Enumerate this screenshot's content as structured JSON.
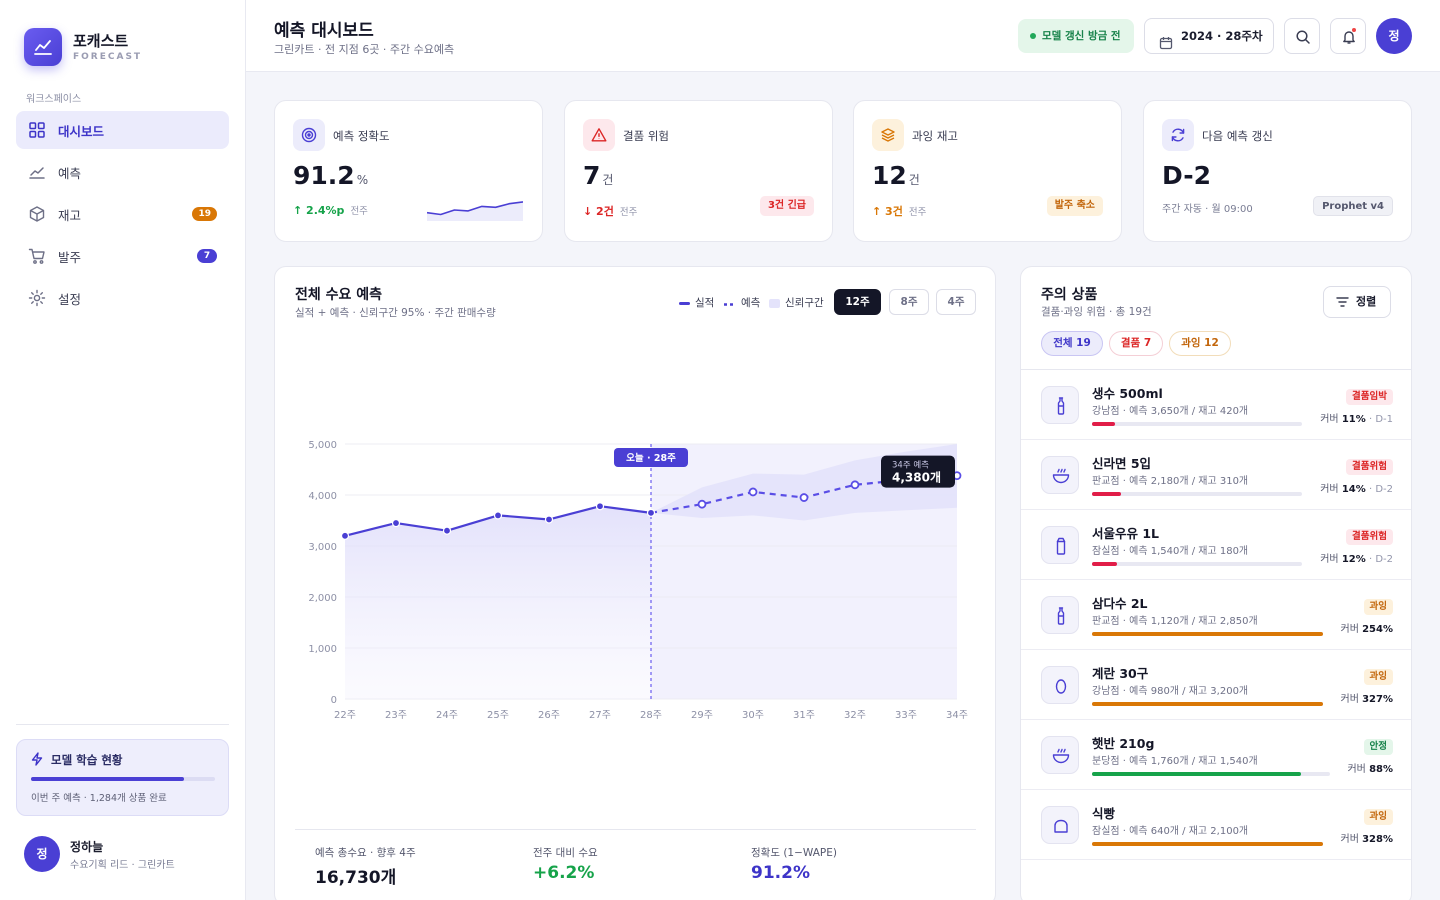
{
  "brand": {
    "name": "포캐스트",
    "sub": "FORECAST"
  },
  "sidebar": {
    "section_label": "워크스페이스",
    "items": [
      {
        "label": "대시보드",
        "icon": "grid-icon",
        "active": true
      },
      {
        "label": "예측",
        "icon": "trend-icon"
      },
      {
        "label": "재고",
        "icon": "box-icon",
        "badge": "19",
        "badge_color": "#d97706"
      },
      {
        "label": "발주",
        "icon": "cart-icon",
        "badge": "7",
        "badge_color": "#4a3fd4"
      },
      {
        "label": "설정",
        "icon": "gear-icon"
      }
    ],
    "training": {
      "title": "모델 학습 현황",
      "progress": 0.83,
      "text": "이번 주 예측 · 1,284개 상품 완료"
    },
    "user": {
      "initial": "정",
      "name": "정하늘",
      "role": "수요기획 리드 · 그린카트"
    }
  },
  "header": {
    "title": "예측 대시보드",
    "subtitle": "그린카트 · 전 지점 6곳 · 주간 수요예측",
    "status": "모델 갱신 방금 전",
    "date": "2024 · 28주차",
    "avatar": "정"
  },
  "kpis": [
    {
      "label": "예측 정확도",
      "value": "91.2",
      "unit": "%",
      "delta": "↑ 2.4%p",
      "delta_sub": "전주",
      "delta_color": "#16a34a",
      "icon": "target-icon",
      "icon_bg": "#ececfb",
      "icon_color": "#4a3fd4",
      "spark": [
        0.35,
        0.25,
        0.5,
        0.45,
        0.7,
        0.65,
        0.85,
        0.95
      ]
    },
    {
      "label": "결품 위험",
      "value": "7",
      "unit": "건",
      "delta": "↓ 2건",
      "delta_sub": "전주",
      "delta_color": "#dc2626",
      "tag": "3건 긴급",
      "tag_bg": "#fde8ec",
      "tag_color": "#dc2626",
      "icon": "warning-icon",
      "icon_bg": "#fde8ec",
      "icon_color": "#dc2626"
    },
    {
      "label": "과잉 재고",
      "value": "12",
      "unit": "건",
      "delta": "↑ 3건",
      "delta_sub": "전주",
      "delta_color": "#d97706",
      "tag": "발주 축소",
      "tag_bg": "#fdf1dc",
      "tag_color": "#c2650a",
      "icon": "layers-icon",
      "icon_bg": "#fdf1dc",
      "icon_color": "#d97706"
    },
    {
      "label": "다음 예측 갱신",
      "value": "D-2",
      "unit": "",
      "delta": "주간 자동 · 월 09:00",
      "delta_sub": "",
      "delta_color": "#7a7d94",
      "tag": "Prophet v4",
      "tag_bg": "#f0f1f6",
      "tag_color": "#55586e",
      "icon": "refresh-icon",
      "icon_bg": "#ececfb",
      "icon_color": "#4a3fd4"
    }
  ],
  "forecast": {
    "title": "전체 수요 예측",
    "subtitle": "실적 + 예측 · 신뢰구간 95% · 주간 판매수량",
    "legend": {
      "actual": "실적",
      "forecast": "예측",
      "ci": "신뢰구간"
    },
    "ranges": [
      "12주",
      "8주",
      "4주"
    ],
    "active_range": "12주",
    "today_label": "오늘 · 28주",
    "tooltip": {
      "title": "34주 예측",
      "value": "4,380개"
    },
    "summary": [
      {
        "label": "예측 총수요 · 향후 4주",
        "value": "16,730개",
        "color": "#141627"
      },
      {
        "label": "전주 대비 수요",
        "value": "+6.2%",
        "color": "#16a34a"
      },
      {
        "label": "정확도 (1−WAPE)",
        "value": "91.2%",
        "color": "#3d34c8"
      }
    ]
  },
  "chart_data": {
    "type": "line",
    "x": [
      "22주",
      "23주",
      "24주",
      "25주",
      "26주",
      "27주",
      "28주",
      "29주",
      "30주",
      "31주",
      "32주",
      "33주",
      "34주"
    ],
    "ylim": [
      0,
      5000
    ],
    "yticks": [
      0,
      1000,
      2000,
      3000,
      4000,
      5000
    ],
    "ytick_labels": [
      "0",
      "1,000",
      "2,000",
      "3,000",
      "4,000",
      "5,000"
    ],
    "grid": true,
    "legend_position": "top-right",
    "series": [
      {
        "name": "실적",
        "values": [
          3200,
          3450,
          3300,
          3600,
          3520,
          3780,
          3650,
          null,
          null,
          null,
          null,
          null,
          null
        ]
      },
      {
        "name": "예측",
        "values": [
          null,
          null,
          null,
          null,
          null,
          null,
          3650,
          3820,
          4060,
          3950,
          4200,
          4300,
          4380
        ]
      }
    ],
    "ci": {
      "lower": [
        null,
        null,
        null,
        null,
        null,
        null,
        3650,
        3550,
        3600,
        3500,
        3650,
        3700,
        3750
      ],
      "upper": [
        null,
        null,
        null,
        null,
        null,
        null,
        3650,
        4150,
        4420,
        4400,
        4680,
        4850,
        5000
      ]
    },
    "colors": {
      "actual": "#4a3fd4",
      "forecast": "#5a4ee6",
      "ci": "#e4e3fb"
    }
  },
  "items": {
    "title": "주의 상품",
    "subtitle": "결품·과잉 위험 · 총 19건",
    "sort_label": "정렬",
    "filters": [
      {
        "label": "전체 19",
        "bg": "#ececfb",
        "color": "#3d34c8",
        "border": "#c9c6f3"
      },
      {
        "label": "결품 7",
        "bg": "#fff",
        "color": "#dc2626",
        "border": "#f4cfd6"
      },
      {
        "label": "과잉 12",
        "bg": "#fff",
        "color": "#c2650a",
        "border": "#f2ddba"
      }
    ],
    "list": [
      {
        "name": "생수 500ml",
        "meta": "강남점 · 예측 3,650개 / 재고 420개",
        "tag": "결품임박",
        "tag_bg": "#fde8ec",
        "tag_color": "#dc2626",
        "cover_label": "커버",
        "cover_value": "11%",
        "dday": "D-1",
        "bar": 0.11,
        "bar_color": "#e11d48",
        "icon": "bottle-icon"
      },
      {
        "name": "신라면 5입",
        "meta": "판교점 · 예측 2,180개 / 재고 310개",
        "tag": "결품위험",
        "tag_bg": "#fde8ec",
        "tag_color": "#dc2626",
        "cover_label": "커버",
        "cover_value": "14%",
        "dday": "D-2",
        "bar": 0.14,
        "bar_color": "#e11d48",
        "icon": "bowl-icon"
      },
      {
        "name": "서울우유 1L",
        "meta": "잠실점 · 예측 1,540개 / 재고 180개",
        "tag": "결품위험",
        "tag_bg": "#fde8ec",
        "tag_color": "#dc2626",
        "cover_label": "커버",
        "cover_value": "12%",
        "dday": "D-2",
        "bar": 0.12,
        "bar_color": "#e11d48",
        "icon": "carton-icon"
      },
      {
        "name": "삼다수 2L",
        "meta": "판교점 · 예측 1,120개 / 재고 2,850개",
        "tag": "과잉",
        "tag_bg": "#fdf1dc",
        "tag_color": "#c2650a",
        "cover_label": "커버",
        "cover_value": "254%",
        "dday": "",
        "bar": 1.0,
        "bar_color": "#d97706",
        "icon": "bottle-icon"
      },
      {
        "name": "계란 30구",
        "meta": "강남점 · 예측 980개 / 재고 3,200개",
        "tag": "과잉",
        "tag_bg": "#fdf1dc",
        "tag_color": "#c2650a",
        "cover_label": "커버",
        "cover_value": "327%",
        "dday": "",
        "bar": 1.0,
        "bar_color": "#d97706",
        "icon": "egg-icon"
      },
      {
        "name": "햇반 210g",
        "meta": "분당점 · 예측 1,760개 / 재고 1,540개",
        "tag": "안정",
        "tag_bg": "#e4f6ea",
        "tag_color": "#17824a",
        "cover_label": "커버",
        "cover_value": "88%",
        "dday": "",
        "bar": 0.88,
        "bar_color": "#16a34a",
        "icon": "bowl-icon"
      },
      {
        "name": "식빵",
        "meta": "잠실점 · 예측 640개 / 재고 2,100개",
        "tag": "과잉",
        "tag_bg": "#fdf1dc",
        "tag_color": "#c2650a",
        "cover_label": "커버",
        "cover_value": "328%",
        "dday": "",
        "bar": 1.0,
        "bar_color": "#d97706",
        "icon": "bread-icon"
      }
    ]
  }
}
